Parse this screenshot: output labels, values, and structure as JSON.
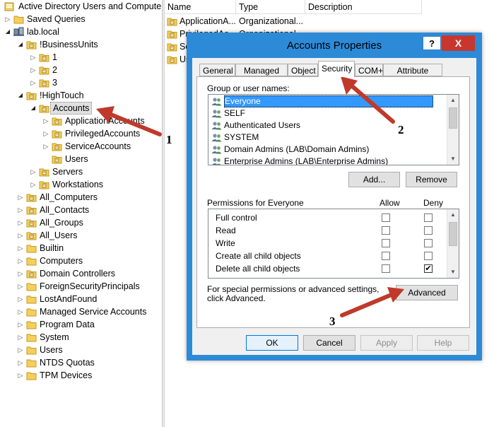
{
  "tree": {
    "items": [
      {
        "label": "Active Directory Users and Computer",
        "depth": 0,
        "expander": "none",
        "icon": "ad-console-icon"
      },
      {
        "label": "Saved Queries",
        "depth": 1,
        "expander": "collapsed",
        "icon": "folder-icon"
      },
      {
        "label": "lab.local",
        "depth": 1,
        "expander": "expanded",
        "icon": "domain-icon"
      },
      {
        "label": "!BusinessUnits",
        "depth": 2,
        "expander": "expanded",
        "icon": "ou-icon"
      },
      {
        "label": "1",
        "depth": 3,
        "expander": "collapsed",
        "icon": "ou-icon"
      },
      {
        "label": "2",
        "depth": 3,
        "expander": "collapsed",
        "icon": "ou-icon"
      },
      {
        "label": "3",
        "depth": 3,
        "expander": "collapsed",
        "icon": "ou-icon"
      },
      {
        "label": "!HighTouch",
        "depth": 2,
        "expander": "expanded",
        "icon": "ou-icon"
      },
      {
        "label": "Accounts",
        "depth": 3,
        "expander": "expanded",
        "icon": "ou-icon",
        "selected": true
      },
      {
        "label": "ApplicationAccounts",
        "depth": 4,
        "expander": "collapsed",
        "icon": "ou-icon"
      },
      {
        "label": "PrivilegedAccounts",
        "depth": 4,
        "expander": "collapsed",
        "icon": "ou-icon"
      },
      {
        "label": "ServiceAccounts",
        "depth": 4,
        "expander": "collapsed",
        "icon": "ou-icon"
      },
      {
        "label": "Users",
        "depth": 4,
        "expander": "none",
        "icon": "ou-icon"
      },
      {
        "label": "Servers",
        "depth": 3,
        "expander": "collapsed",
        "icon": "ou-icon"
      },
      {
        "label": "Workstations",
        "depth": 3,
        "expander": "collapsed",
        "icon": "ou-icon"
      },
      {
        "label": "All_Computers",
        "depth": 2,
        "expander": "collapsed",
        "icon": "ou-icon"
      },
      {
        "label": "All_Contacts",
        "depth": 2,
        "expander": "collapsed",
        "icon": "ou-icon"
      },
      {
        "label": "All_Groups",
        "depth": 2,
        "expander": "collapsed",
        "icon": "ou-icon"
      },
      {
        "label": "All_Users",
        "depth": 2,
        "expander": "collapsed",
        "icon": "ou-icon"
      },
      {
        "label": "Builtin",
        "depth": 2,
        "expander": "collapsed",
        "icon": "folder-icon"
      },
      {
        "label": "Computers",
        "depth": 2,
        "expander": "collapsed",
        "icon": "folder-icon"
      },
      {
        "label": "Domain Controllers",
        "depth": 2,
        "expander": "collapsed",
        "icon": "ou-icon"
      },
      {
        "label": "ForeignSecurityPrincipals",
        "depth": 2,
        "expander": "collapsed",
        "icon": "folder-icon"
      },
      {
        "label": "LostAndFound",
        "depth": 2,
        "expander": "collapsed",
        "icon": "folder-icon"
      },
      {
        "label": "Managed Service Accounts",
        "depth": 2,
        "expander": "collapsed",
        "icon": "folder-icon"
      },
      {
        "label": "Program Data",
        "depth": 2,
        "expander": "collapsed",
        "icon": "folder-icon"
      },
      {
        "label": "System",
        "depth": 2,
        "expander": "collapsed",
        "icon": "folder-icon"
      },
      {
        "label": "Users",
        "depth": 2,
        "expander": "collapsed",
        "icon": "folder-icon"
      },
      {
        "label": "NTDS Quotas",
        "depth": 2,
        "expander": "collapsed",
        "icon": "folder-icon"
      },
      {
        "label": "TPM Devices",
        "depth": 2,
        "expander": "collapsed",
        "icon": "folder-icon"
      }
    ]
  },
  "list": {
    "columns": [
      "Name",
      "Type",
      "Description"
    ],
    "rows": [
      {
        "name": "ApplicationA...",
        "type": "Organizational..."
      },
      {
        "name": "PrivilegedAc...",
        "type": "Organizational..."
      },
      {
        "name": "Se",
        "type": ""
      },
      {
        "name": "Us",
        "type": ""
      }
    ]
  },
  "dialog": {
    "title": "Accounts Properties",
    "help_label": "?",
    "close_label": "X",
    "tabs": [
      "General",
      "Managed By",
      "Object",
      "Security",
      "COM+",
      "Attribute Editor"
    ],
    "active_tab": "Security",
    "group_label": "Group or user names:",
    "users": [
      "Everyone",
      "SELF",
      "Authenticated Users",
      "SYSTEM",
      "Domain Admins (LAB\\Domain Admins)",
      "Enterprise Admins (LAB\\Enterprise Admins)"
    ],
    "add_label": "Add...",
    "remove_label": "Remove",
    "perm_label": "Permissions for Everyone",
    "allow_label": "Allow",
    "deny_label": "Deny",
    "permissions": [
      {
        "name": "Full control",
        "allow": false,
        "deny": false
      },
      {
        "name": "Read",
        "allow": false,
        "deny": false
      },
      {
        "name": "Write",
        "allow": false,
        "deny": false
      },
      {
        "name": "Create all child objects",
        "allow": false,
        "deny": false
      },
      {
        "name": "Delete all child objects",
        "allow": false,
        "deny": true
      }
    ],
    "special_text": "For special permissions or advanced settings, click Advanced.",
    "advanced_label": "Advanced",
    "ok_label": "OK",
    "cancel_label": "Cancel",
    "apply_label": "Apply",
    "help_button_label": "Help"
  },
  "annotations": [
    "1",
    "2",
    "3"
  ],
  "colors": {
    "arrow": "#c0392b",
    "title_bar": "#2d8ad6",
    "selection": "#3399ff",
    "close": "#c7372f"
  }
}
